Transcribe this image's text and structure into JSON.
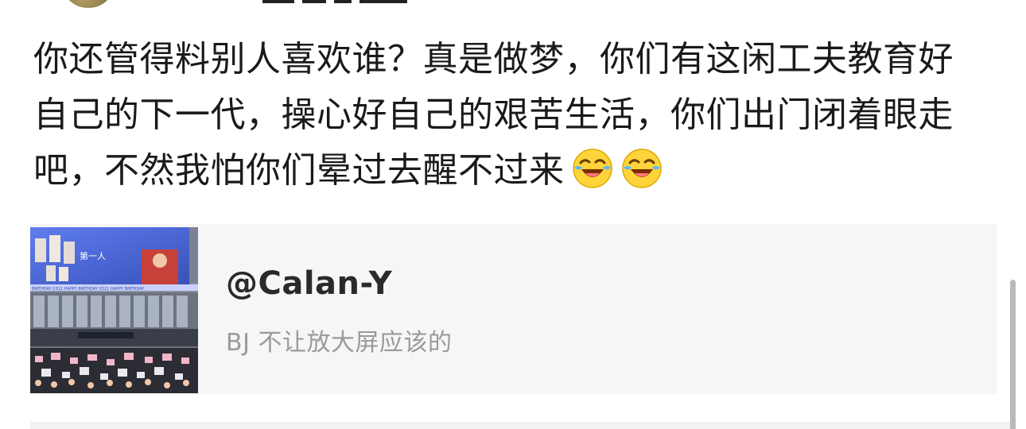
{
  "post": {
    "text": "你还管得料别人喜欢谁？真是做梦，你们有这闲工夫教育好自己的下一代，操心好自己的艰苦生活，你们出门闭着眼走吧，不然我怕你们晕过去醒不过来",
    "emojis": [
      "laughing-crying-emoji",
      "laughing-crying-emoji"
    ]
  },
  "quoted": {
    "author": "@Calan-Y",
    "snippet": "BJ 不让放大屏应该的",
    "thumbnail": {
      "screen_caption": "第一人",
      "banner_text": "BIRTHDAY 0311 HAPPY BIRTHDAY 0311 HAPPY BIRTHDAY"
    }
  },
  "colors": {
    "text": "#1a1a1a",
    "card_bg": "#f6f6f6",
    "snippet": "#9a9a9a",
    "scrollbar": "#b9b9b9"
  }
}
